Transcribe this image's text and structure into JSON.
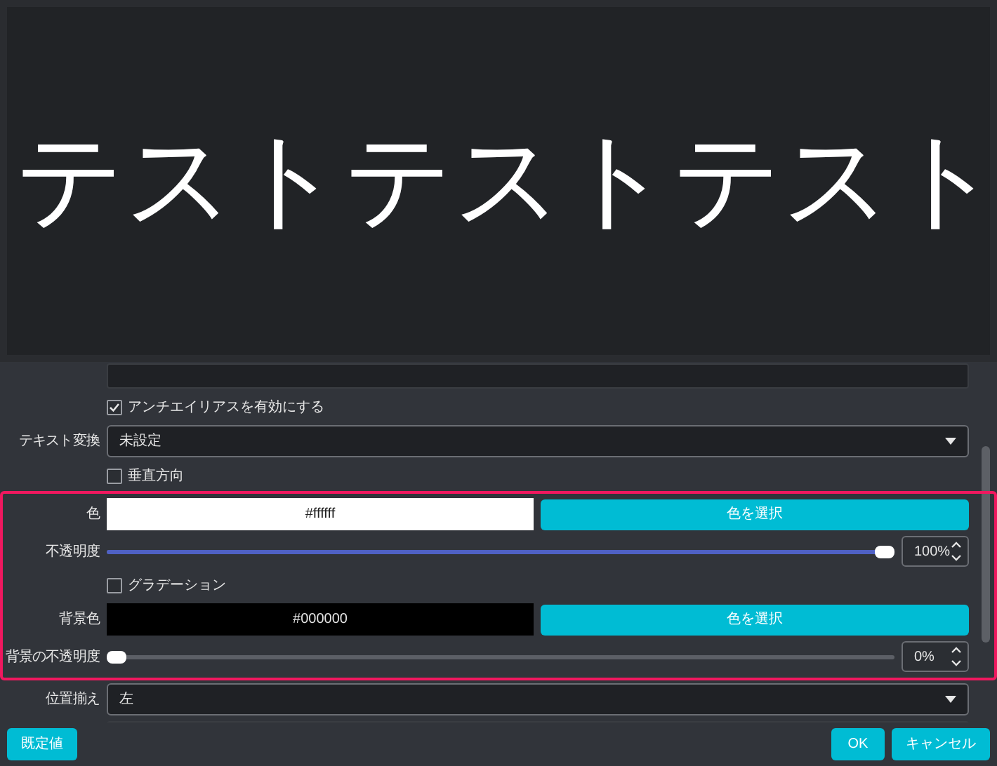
{
  "preview": {
    "text": "テストテストテスト"
  },
  "rows": [
    {
      "kind": "field"
    },
    {
      "kind": "checkbox",
      "label": "アンチエイリアスを有効にする",
      "checked": true
    },
    {
      "kind": "select",
      "label": "テキスト変換",
      "value": "未設定"
    },
    {
      "kind": "checkbox",
      "label": "垂直方向",
      "checked": false
    }
  ],
  "highlight_box": {
    "rows": [
      {
        "kind": "color",
        "label": "色",
        "value": "#ffffff",
        "color": "#ffffff",
        "button": "色を選択"
      },
      {
        "kind": "slider",
        "label": "不透明度",
        "level": 1,
        "reading": "100%"
      },
      {
        "kind": "checkbox",
        "label": "グラデーション",
        "checked": false
      },
      {
        "kind": "color",
        "label": "背景色",
        "value": "#000000",
        "color": "#000000",
        "button": "色を選択"
      },
      {
        "kind": "slider",
        "label": "背景の不透明度",
        "level": 0,
        "reading": "0%"
      }
    ]
  },
  "more_rows": [
    {
      "kind": "select",
      "label": "位置揃え",
      "value": "左"
    },
    {
      "kind": "field"
    }
  ],
  "buttons": {
    "left": [
      {
        "label": "既定値"
      }
    ],
    "right": [
      {
        "label": "OK"
      },
      {
        "label": "キャンセル"
      }
    ]
  }
}
